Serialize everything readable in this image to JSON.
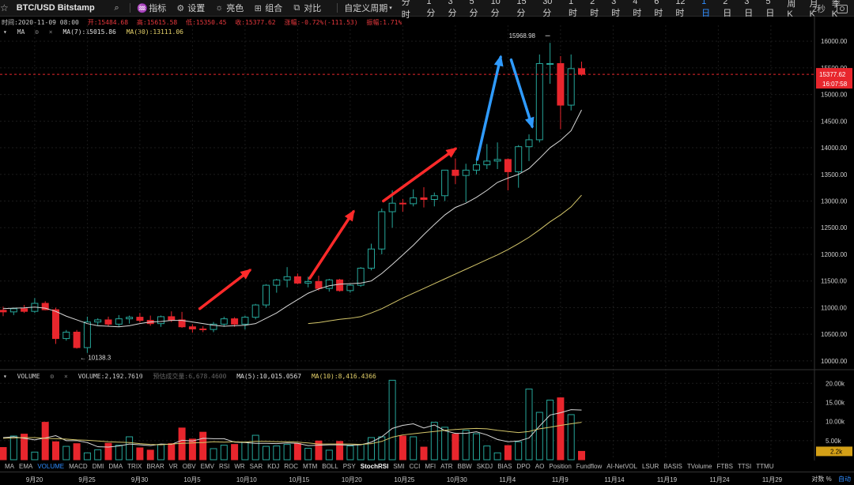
{
  "toolbar": {
    "symbol": "BTC/USD Bitstamp",
    "indicators": "指标",
    "settings": "设置",
    "brightness": "亮色",
    "combo": "组合",
    "compare": "对比",
    "custom_period": "自定义周期",
    "periods": [
      "分时",
      "1分",
      "3分",
      "5分",
      "10分",
      "15分",
      "30分",
      "1时",
      "2时",
      "3时",
      "4时",
      "6时",
      "12时",
      "1日",
      "2日",
      "3日",
      "5日",
      "周K",
      "月K",
      "季K"
    ],
    "active_period": "1日",
    "refresh": "2秒"
  },
  "infobar": {
    "time": "时间:2020-11-09 08:00",
    "open": "开:15484.68",
    "high": "高:15615.58",
    "low": "低:15350.45",
    "close": "收:15377.62",
    "change": "涨幅:-0.72%(-111.53)",
    "amplitude": "振幅:1.71%"
  },
  "ma_legend": {
    "label": "MA",
    "ma7": "MA(7):15015.86",
    "ma30": "MA(30):13111.06"
  },
  "volume_legend": {
    "label": "VOLUME",
    "volume": "VOLUME:2,192.7610",
    "estimate": "预估成交量:6,678.4600",
    "ma5": "MA(5):10,015.0567",
    "ma10": "MA(10):8,416.4366"
  },
  "indicator_tabs": [
    "MA",
    "EMA",
    "VOLUME",
    "MACD",
    "DMI",
    "DMA",
    "TRIX",
    "BRAR",
    "VR",
    "OBV",
    "EMV",
    "RSI",
    "WR",
    "SAR",
    "KDJ",
    "ROC",
    "MTM",
    "BOLL",
    "PSY",
    "StochRSI",
    "SMI",
    "CCI",
    "MFI",
    "ATR",
    "BBW",
    "SKDJ",
    "BIAS",
    "DPO",
    "AO",
    "Position",
    "Fundflow",
    "AI-NetVOL",
    "LSUR",
    "BASIS",
    "TVolume",
    "FTBS",
    "TTSI",
    "TTMU"
  ],
  "bottom_right": {
    "log": "对数",
    "pct": "%",
    "auto": "自动"
  },
  "colors": {
    "up": "#26a69a",
    "down": "#e8262d",
    "ma7": "#d8d8d8",
    "ma30": "#d4c66a",
    "arrow_red": "#ff2a2a",
    "arrow_blue": "#2f9bff",
    "accent": "#2f8cff"
  },
  "chart_data": {
    "type": "candlestick",
    "price_axis": {
      "ticks": [
        10000,
        10500,
        11000,
        11500,
        12000,
        12500,
        13000,
        13500,
        14000,
        14500,
        15000,
        15500,
        16000
      ],
      "labels": [
        "10000.00",
        "10500.00",
        "11000.00",
        "11500.00",
        "12000.00",
        "12500.00",
        "13000.00",
        "13500.00",
        "14000.00",
        "14500.00",
        "15000.00",
        "15500.00",
        "16000.00"
      ],
      "range": [
        9880,
        16150
      ]
    },
    "last_price_label": "15377.62",
    "countdown_label": "16:07:58",
    "high_annotation": "15968.98",
    "low_annotation": "10138.3",
    "volume_axis": {
      "ticks": [
        5000,
        10000,
        15000,
        20000
      ],
      "labels": [
        "5.00k",
        "10.00k",
        "15.00k",
        "20.00k"
      ],
      "range": [
        0,
        21500
      ],
      "current_label": "2.2k"
    },
    "date_labels": [
      {
        "text": "9月20",
        "index": 3
      },
      {
        "text": "9月25",
        "index": 8
      },
      {
        "text": "9月30",
        "index": 13
      },
      {
        "text": "10月5",
        "index": 18
      },
      {
        "text": "10月10",
        "index": 23
      },
      {
        "text": "10月15",
        "index": 28
      },
      {
        "text": "10月20",
        "index": 33
      },
      {
        "text": "10月25",
        "index": 38
      },
      {
        "text": "10月30",
        "index": 43
      },
      {
        "text": "11月4",
        "index": 48
      },
      {
        "text": "11月9",
        "index": 53
      },
      {
        "text": "11月14",
        "index": 58
      },
      {
        "text": "11月19",
        "index": 63
      },
      {
        "text": "11月24",
        "index": 68
      },
      {
        "text": "11月29",
        "index": 73
      }
    ],
    "candles": [
      [
        10950,
        11020,
        10840,
        10920
      ],
      [
        10920,
        11000,
        10860,
        10980
      ],
      [
        10980,
        11050,
        10900,
        10930
      ],
      [
        10930,
        11180,
        10900,
        11080
      ],
      [
        11080,
        11120,
        10950,
        10960
      ],
      [
        10960,
        11000,
        10320,
        10420
      ],
      [
        10420,
        10580,
        10380,
        10540
      ],
      [
        10540,
        10580,
        10230,
        10250
      ],
      [
        10250,
        10830,
        10150,
        10730
      ],
      [
        10730,
        10800,
        10660,
        10770
      ],
      [
        10770,
        10830,
        10650,
        10690
      ],
      [
        10690,
        10860,
        10640,
        10790
      ],
      [
        10790,
        10850,
        10700,
        10820
      ],
      [
        10820,
        10900,
        10720,
        10760
      ],
      [
        10760,
        10850,
        10660,
        10700
      ],
      [
        10700,
        10850,
        10640,
        10830
      ],
      [
        10830,
        10930,
        10730,
        10770
      ],
      [
        10770,
        10920,
        10620,
        10640
      ],
      [
        10640,
        10690,
        10530,
        10600
      ],
      [
        10600,
        10650,
        10540,
        10590
      ],
      [
        10590,
        10730,
        10540,
        10690
      ],
      [
        10690,
        10830,
        10640,
        10790
      ],
      [
        10790,
        10820,
        10640,
        10690
      ],
      [
        10690,
        10850,
        10590,
        10820
      ],
      [
        10820,
        11070,
        10780,
        11050
      ],
      [
        11050,
        11440,
        11000,
        11420
      ],
      [
        11420,
        11540,
        11280,
        11520
      ],
      [
        11520,
        11760,
        11380,
        11580
      ],
      [
        11580,
        11640,
        11440,
        11460
      ],
      [
        11460,
        11580,
        11380,
        11490
      ],
      [
        11490,
        11600,
        11320,
        11360
      ],
      [
        11360,
        11540,
        11300,
        11520
      ],
      [
        11520,
        11540,
        11300,
        11320
      ],
      [
        11320,
        11440,
        11280,
        11420
      ],
      [
        11420,
        11760,
        11390,
        11740
      ],
      [
        11740,
        12200,
        11700,
        12100
      ],
      [
        12100,
        12860,
        12000,
        12800
      ],
      [
        12800,
        13200,
        12500,
        12960
      ],
      [
        12960,
        13040,
        12800,
        12950
      ],
      [
        12950,
        13220,
        12900,
        13060
      ],
      [
        13060,
        13260,
        12880,
        13030
      ],
      [
        13030,
        13160,
        12900,
        13100
      ],
      [
        13100,
        13580,
        13000,
        13580
      ],
      [
        13580,
        13800,
        13320,
        13480
      ],
      [
        13480,
        13700,
        12980,
        13580
      ],
      [
        13580,
        13800,
        13500,
        13680
      ],
      [
        13680,
        14070,
        13600,
        13750
      ],
      [
        13750,
        14100,
        13600,
        13780
      ],
      [
        13780,
        13800,
        13200,
        13550
      ],
      [
        13550,
        14050,
        13250,
        14020
      ],
      [
        14020,
        14250,
        13750,
        14150
      ],
      [
        14150,
        15750,
        14100,
        15580
      ],
      [
        15580,
        15969,
        15200,
        15580
      ],
      [
        15580,
        15720,
        14350,
        14800
      ],
      [
        14800,
        15750,
        14700,
        15485
      ],
      [
        15485,
        15616,
        15350,
        15378
      ]
    ],
    "ma7": [
      10980,
      10990,
      10995,
      11010,
      10990,
      10930,
      10840,
      10770,
      10700,
      10660,
      10650,
      10640,
      10660,
      10700,
      10730,
      10740,
      10760,
      10760,
      10730,
      10700,
      10670,
      10650,
      10660,
      10670,
      10700,
      10800,
      10900,
      11030,
      11150,
      11270,
      11350,
      11410,
      11440,
      11450,
      11460,
      11500,
      11640,
      11810,
      11990,
      12170,
      12370,
      12560,
      12740,
      12880,
      12960,
      13070,
      13200,
      13350,
      13430,
      13500,
      13610,
      13800,
      14000,
      14140,
      14320,
      14710
    ],
    "ma30": [
      null,
      null,
      null,
      null,
      null,
      null,
      null,
      null,
      null,
      null,
      null,
      null,
      null,
      null,
      null,
      null,
      null,
      null,
      null,
      null,
      null,
      null,
      null,
      null,
      null,
      null,
      null,
      null,
      null,
      10700,
      10720,
      10750,
      10780,
      10800,
      10830,
      10900,
      10980,
      11080,
      11180,
      11270,
      11360,
      11450,
      11540,
      11630,
      11720,
      11810,
      11900,
      11990,
      12090,
      12200,
      12320,
      12460,
      12610,
      12740,
      12890,
      13111
    ],
    "volume": [
      3200,
      6200,
      6700,
      2000,
      9800,
      4700,
      3500,
      4200,
      1800,
      2600,
      4300,
      3800,
      6000,
      3100,
      2500,
      4000,
      4200,
      8300,
      5400,
      7200,
      2900,
      3800,
      4000,
      4600,
      6400,
      3500,
      3600,
      4000,
      4200,
      3000,
      4900,
      2500,
      4800,
      3600,
      4000,
      5800,
      6000,
      20800,
      6200,
      6000,
      3300,
      9800,
      8500,
      6700,
      7700,
      6800,
      3600,
      1800,
      3700,
      4700,
      18500,
      12400,
      15600,
      16200,
      11800,
      2190
    ],
    "volume_ma5": [
      5800,
      6000,
      5600,
      5200,
      5700,
      6300,
      5000,
      5000,
      4500,
      3400,
      3300,
      3600,
      4100,
      3900,
      3700,
      4100,
      4000,
      5100,
      4900,
      5600,
      5500,
      5500,
      4600,
      4500,
      4300,
      4300,
      4200,
      4400,
      4300,
      3700,
      3800,
      3900,
      3900,
      3800,
      3900,
      4600,
      6000,
      8200,
      9000,
      9400,
      8300,
      9100,
      7600,
      6900,
      6900,
      7300,
      6500,
      5300,
      4700,
      4900,
      5700,
      8800,
      11700,
      12300,
      13100,
      13000
    ],
    "volume_ma10": [
      5600,
      5700,
      5800,
      5800,
      5600,
      5500,
      5400,
      5200,
      5100,
      4900,
      4700,
      4600,
      4500,
      4200,
      4000,
      3900,
      4100,
      4300,
      4400,
      4500,
      4700,
      4600,
      4700,
      4600,
      4800,
      4800,
      4700,
      4700,
      4600,
      4400,
      4100,
      4100,
      4100,
      4100,
      4000,
      4200,
      4800,
      5900,
      6500,
      6800,
      7100,
      7400,
      7700,
      7900,
      8100,
      8200,
      8100,
      7700,
      7400,
      7100,
      7400,
      8100,
      8500,
      9000,
      9400,
      9800
    ]
  }
}
